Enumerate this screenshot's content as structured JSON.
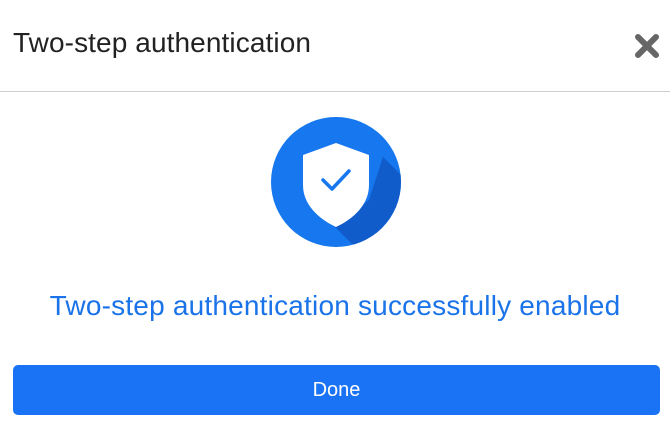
{
  "dialog": {
    "title": "Two-step authentication",
    "close_icon": "close-icon",
    "badge_icon": "shield-check-icon",
    "message": "Two-step authentication successfully enabled",
    "done_label": "Done"
  },
  "colors": {
    "accent": "#1a73f4",
    "badge_circle": "#1677ee",
    "badge_shadow": "#0f57c4",
    "message_text": "#1a73e8",
    "close_icon": "#666666"
  }
}
